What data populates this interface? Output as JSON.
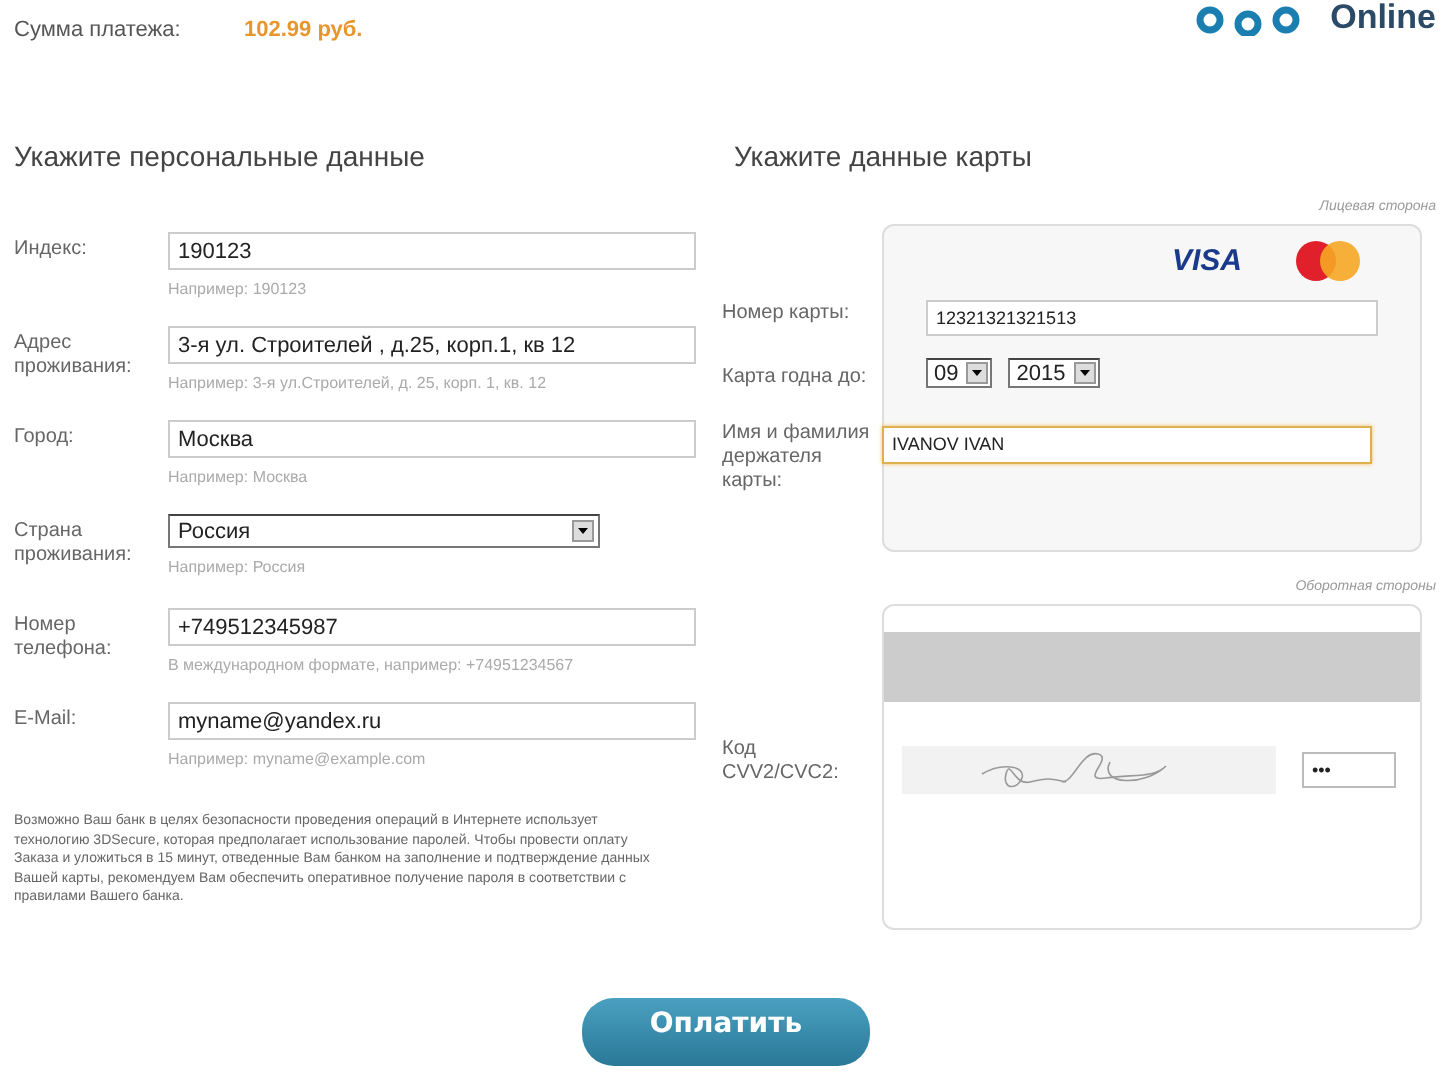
{
  "payment": {
    "label": "Сумма платежа:",
    "amount": "102.99 руб."
  },
  "logo": {
    "text": "Online"
  },
  "personal": {
    "heading": "Укажите персональные данные",
    "fields": [
      {
        "kind": "input",
        "label": "Индекс:",
        "value": "190123",
        "hint": "Например: 190123"
      },
      {
        "kind": "input",
        "label": "Адрес проживания:",
        "value": "3-я ул. Строителей , д.25, корп.1, кв 12",
        "hint": "Например: 3-я ул.Строителей, д. 25, корп. 1, кв. 12"
      },
      {
        "kind": "input",
        "label": "Город:",
        "value": "Москва",
        "hint": "Например: Москва"
      },
      {
        "kind": "select",
        "label": "Страна проживания:",
        "value": "Россия",
        "hint": "Например: Россия"
      },
      {
        "kind": "input",
        "label": "Номер телефона:",
        "value": "+749512345987",
        "hint": "В международном формате, например: +74951234567"
      },
      {
        "kind": "input",
        "label": "E-Mail:",
        "value": "myname@yandex.ru",
        "hint": "Например: myname@example.com"
      }
    ],
    "notice": "Возможно Ваш банк в целях безопасности проведения операций в Интернете использует технологию 3DSecure, которая предполагает использование паролей. Чтобы провести оплату Заказа и уложиться в 15 минут, отведенные Вам банком на заполнение и подтверждение данных Вашей карты, рекомендуем Вам обеспечить оперативное получение пароля в соответствии с правилами Вашего банка."
  },
  "card": {
    "heading": "Укажите данные карты",
    "front_caption": "Лицевая сторона",
    "brand": "VISA",
    "number_label": "Номер карты:",
    "number": "12321321321513",
    "expiry_label": "Карта годна до:",
    "expiry_month": "09",
    "expiry_year": "2015",
    "holder_label": "Имя и фамилия держателя карты:",
    "holder": "IVANOV IVAN",
    "holder_focused": true,
    "back_caption": "Оборотная стороны",
    "cvv_label": "Код CVV2/CVC2:",
    "cvv": "•••"
  },
  "pay_button": "Оплатить"
}
